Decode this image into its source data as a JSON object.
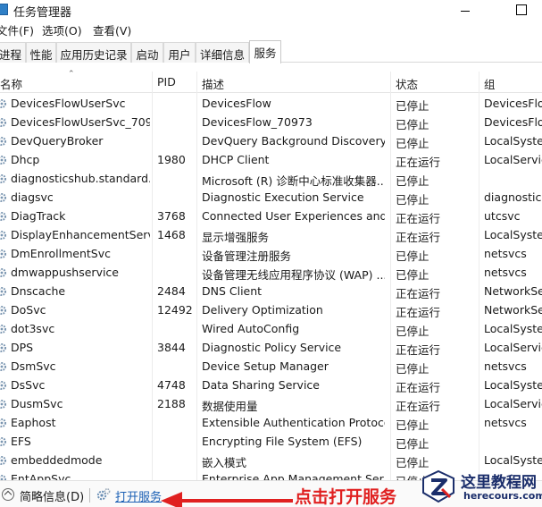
{
  "window": {
    "title": "任务管理器"
  },
  "menu": {
    "file": "文件(F)",
    "options": "选项(O)",
    "view": "查看(V)"
  },
  "tabs": [
    {
      "label": "进程"
    },
    {
      "label": "性能"
    },
    {
      "label": "应用历史记录"
    },
    {
      "label": "启动"
    },
    {
      "label": "用户"
    },
    {
      "label": "详细信息"
    },
    {
      "label": "服务"
    }
  ],
  "active_tab": "服务",
  "columns": {
    "name": "名称",
    "pid": "PID",
    "desc": "描述",
    "status": "状态",
    "group": "组"
  },
  "services": [
    {
      "name": "DevicesFlowUserSvc",
      "pid": "",
      "desc": "DevicesFlow",
      "status": "已停止",
      "group": "DevicesFlow"
    },
    {
      "name": "DevicesFlowUserSvc_709...",
      "pid": "",
      "desc": "DevicesFlow_70973",
      "status": "已停止",
      "group": "DevicesFlow"
    },
    {
      "name": "DevQueryBroker",
      "pid": "",
      "desc": "DevQuery Background Discovery...",
      "status": "已停止",
      "group": "LocalSystem"
    },
    {
      "name": "Dhcp",
      "pid": "1980",
      "desc": "DHCP Client",
      "status": "正在运行",
      "group": "LocalService"
    },
    {
      "name": "diagnosticshub.standard...",
      "pid": "",
      "desc": "Microsoft (R) 诊断中心标准收集器...",
      "status": "已停止",
      "group": ""
    },
    {
      "name": "diagsvc",
      "pid": "",
      "desc": "Diagnostic Execution Service",
      "status": "已停止",
      "group": "diagnostics"
    },
    {
      "name": "DiagTrack",
      "pid": "3768",
      "desc": "Connected User Experiences and...",
      "status": "正在运行",
      "group": "utcsvc"
    },
    {
      "name": "DisplayEnhancementServ...",
      "pid": "1468",
      "desc": "显示增强服务",
      "status": "正在运行",
      "group": "LocalSystem"
    },
    {
      "name": "DmEnrollmentSvc",
      "pid": "",
      "desc": "设备管理注册服务",
      "status": "已停止",
      "group": "netsvcs"
    },
    {
      "name": "dmwappushservice",
      "pid": "",
      "desc": "设备管理无线应用程序协议 (WAP) ...",
      "status": "已停止",
      "group": "netsvcs"
    },
    {
      "name": "Dnscache",
      "pid": "2484",
      "desc": "DNS Client",
      "status": "正在运行",
      "group": "NetworkSe"
    },
    {
      "name": "DoSvc",
      "pid": "12492",
      "desc": "Delivery Optimization",
      "status": "正在运行",
      "group": "NetworkSe"
    },
    {
      "name": "dot3svc",
      "pid": "",
      "desc": "Wired AutoConfig",
      "status": "已停止",
      "group": "LocalSystem"
    },
    {
      "name": "DPS",
      "pid": "3844",
      "desc": "Diagnostic Policy Service",
      "status": "正在运行",
      "group": "LocalService"
    },
    {
      "name": "DsmSvc",
      "pid": "",
      "desc": "Device Setup Manager",
      "status": "已停止",
      "group": "netsvcs"
    },
    {
      "name": "DsSvc",
      "pid": "4748",
      "desc": "Data Sharing Service",
      "status": "正在运行",
      "group": "LocalSystem"
    },
    {
      "name": "DusmSvc",
      "pid": "2188",
      "desc": "数据使用量",
      "status": "正在运行",
      "group": "LocalService"
    },
    {
      "name": "Eaphost",
      "pid": "",
      "desc": "Extensible Authentication Protocol",
      "status": "已停止",
      "group": "netsvcs"
    },
    {
      "name": "EFS",
      "pid": "",
      "desc": "Encrypting File System (EFS)",
      "status": "已停止",
      "group": ""
    },
    {
      "name": "embeddedmode",
      "pid": "",
      "desc": "嵌入模式",
      "status": "已停止",
      "group": "LocalSystem"
    },
    {
      "name": "EntAppSvc",
      "pid": "",
      "desc": "Enterprise App Management Ser...",
      "status": "已停止",
      "group": ""
    }
  ],
  "footer": {
    "fewer_details": "简略信息(D)",
    "open_services": "打开服务"
  },
  "annotation": {
    "text": "点击打开服务",
    "color": "#e02020"
  },
  "watermark": {
    "title": "这里教程网",
    "url": "herecours.com"
  }
}
